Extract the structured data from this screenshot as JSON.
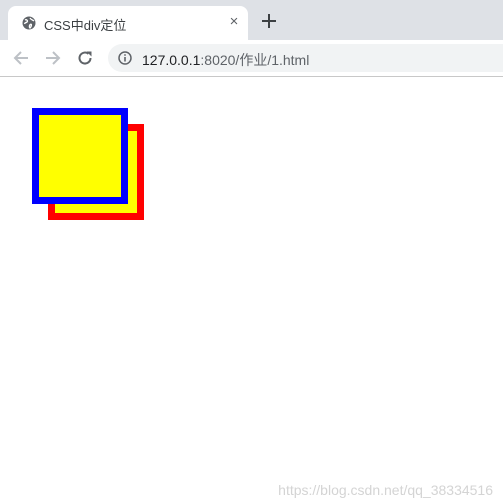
{
  "tab": {
    "title": "CSS中div定位",
    "close_label": "×"
  },
  "toolbar": {
    "url_host": "127.0.0.1",
    "url_path": ":8020/作业/1.html"
  },
  "page": {
    "boxes": [
      {
        "name": "blue-bordered",
        "border_color": "#0000ff",
        "fill": "#ffff00"
      },
      {
        "name": "red-bordered",
        "border_color": "#ff0000",
        "fill": "#ffff00"
      }
    ],
    "watermark": "https://blog.csdn.net/qq_38334516"
  },
  "colors": {
    "tabstrip": "#dee1e6",
    "omnibox": "#f1f3f4"
  }
}
